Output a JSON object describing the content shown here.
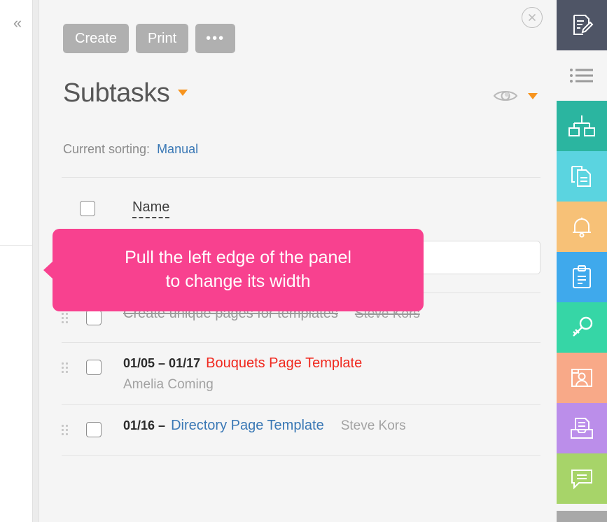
{
  "left": {
    "collapse_icon": "chevrons-left-icon",
    "collapse_label": "«"
  },
  "panel": {
    "close_icon": "close-circle-icon",
    "toolbar": {
      "create_label": "Create",
      "print_label": "Print",
      "more_label": "•••"
    },
    "title": "Subtasks",
    "title_caret_icon": "caret-down-icon",
    "view_icon": "eye-icon",
    "view_caret_icon": "caret-down-icon",
    "sorting_label": "Current sorting:",
    "sorting_value": "Manual",
    "columns": {
      "name": "Name"
    },
    "new_task_placeholder": "",
    "new_task_value": ""
  },
  "tooltip": {
    "line1": "Pull the left edge of the panel",
    "line2": "to change its width",
    "color": "#f8418f"
  },
  "tasks": [
    {
      "date": "",
      "name": "Create unique pages for templates",
      "name_style": "done",
      "assignee": "Steve Kors",
      "assignee_position": "inline"
    },
    {
      "date": "01/05 – 01/17",
      "name": "Bouquets Page Template",
      "name_style": "red",
      "assignee": "Amelia Coming",
      "assignee_position": "below"
    },
    {
      "date": "01/16 –",
      "name": "Directory Page Template",
      "name_style": "blue",
      "assignee": "Steve Kors",
      "assignee_position": "inline"
    }
  ],
  "rail": [
    {
      "name": "edit-document-icon",
      "color": "#4f5566"
    },
    {
      "name": "list-lines-icon",
      "color": "#f5f5f5"
    },
    {
      "name": "org-chart-icon",
      "color": "#2bb5a0"
    },
    {
      "name": "copy-documents-icon",
      "color": "#5bd4e0"
    },
    {
      "name": "bell-icon",
      "color": "#f7c177"
    },
    {
      "name": "clipboard-icon",
      "color": "#3fa9ec"
    },
    {
      "name": "key-icon",
      "color": "#36d6a6"
    },
    {
      "name": "contact-card-icon",
      "color": "#f8a988"
    },
    {
      "name": "archive-folder-icon",
      "color": "#bb8eea"
    },
    {
      "name": "chat-bubble-icon",
      "color": "#a7d469"
    }
  ]
}
